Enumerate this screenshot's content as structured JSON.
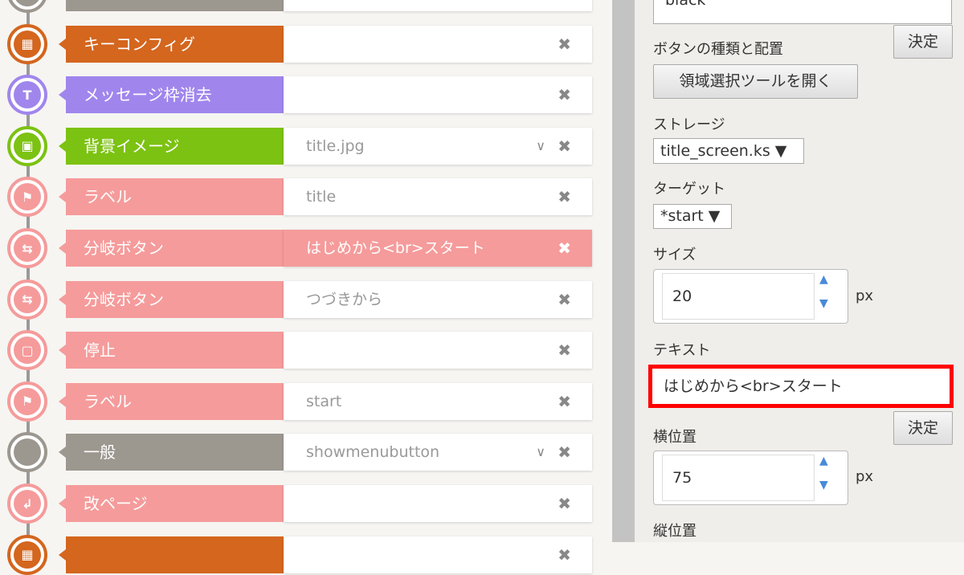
{
  "colors": {
    "orange": "#d4661e",
    "purple": "#a086ec",
    "green": "#7cc212",
    "pink": "#f59b9b",
    "gray": "#9c978f",
    "highlight": "#ff0000"
  },
  "rows": [
    {
      "label": "",
      "value": "",
      "color": "#9c978f",
      "icon": "code-icon",
      "chev": true
    },
    {
      "label": "キーコンフィグ",
      "value": "",
      "color": "#d4661e",
      "icon": "keyboard-icon"
    },
    {
      "label": "メッセージ枠消去",
      "value": "",
      "color": "#a086ec",
      "icon": "text-clear-icon"
    },
    {
      "label": "背景イメージ",
      "value": "title.jpg",
      "color": "#7cc212",
      "icon": "image-icon",
      "chev": true
    },
    {
      "label": "ラベル",
      "value": "title",
      "color": "#f59b9b",
      "icon": "flag-icon"
    },
    {
      "label": "分岐ボタン",
      "value": "はじめから<br>スタート",
      "color": "#f59b9b",
      "icon": "branch-icon",
      "selected": true
    },
    {
      "label": "分岐ボタン",
      "value": "つづきから",
      "color": "#f59b9b",
      "icon": "branch-icon"
    },
    {
      "label": "停止",
      "value": "",
      "color": "#f59b9b",
      "icon": "stop-icon"
    },
    {
      "label": "ラベル",
      "value": "start",
      "color": "#f59b9b",
      "icon": "flag-icon"
    },
    {
      "label": "一般",
      "value": "showmenubutton",
      "color": "#9c978f",
      "icon": "code-icon",
      "chev": true
    },
    {
      "label": "改ページ",
      "value": "",
      "color": "#f59b9b",
      "icon": "page-break-icon"
    },
    {
      "label": "",
      "value": "",
      "color": "#d4661e",
      "icon": "keyboard-icon"
    }
  ],
  "panel": {
    "color_value": "black",
    "decide": "決定",
    "button_type_label": "ボタンの種類と配置",
    "area_tool": "領域選択ツールを開く",
    "storage_label": "ストレージ",
    "storage_value": "title_screen.ks ▼",
    "target_label": "ターゲット",
    "target_value": "*start ▼",
    "size_label": "サイズ",
    "size_value": "20",
    "unit": "px",
    "text_label": "テキスト",
    "text_value": "はじめから<br>スタート",
    "x_label": "横位置",
    "x_value": "75",
    "y_label": "縦位置"
  }
}
